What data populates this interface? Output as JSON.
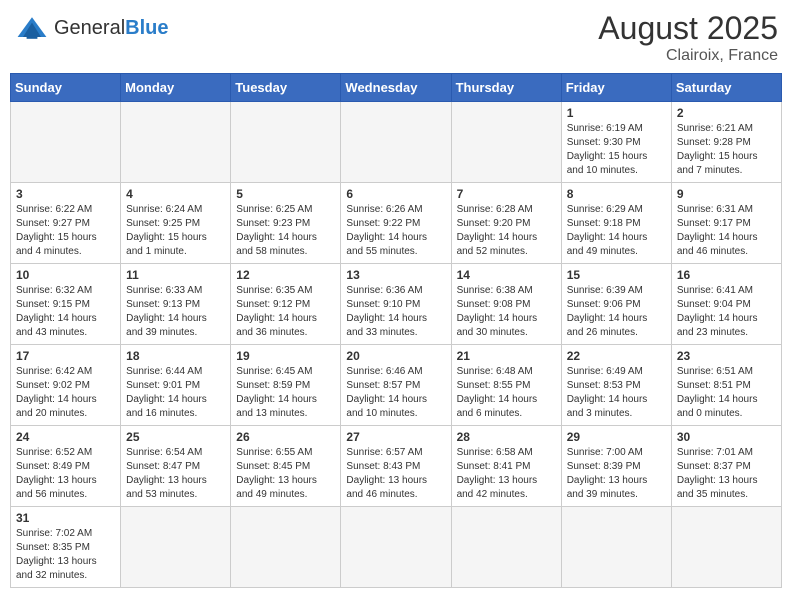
{
  "header": {
    "logo_general": "General",
    "logo_blue": "Blue",
    "month_title": "August 2025",
    "location": "Clairoix, France"
  },
  "days_of_week": [
    "Sunday",
    "Monday",
    "Tuesday",
    "Wednesday",
    "Thursday",
    "Friday",
    "Saturday"
  ],
  "weeks": [
    [
      {
        "day": "",
        "info": ""
      },
      {
        "day": "",
        "info": ""
      },
      {
        "day": "",
        "info": ""
      },
      {
        "day": "",
        "info": ""
      },
      {
        "day": "",
        "info": ""
      },
      {
        "day": "1",
        "info": "Sunrise: 6:19 AM\nSunset: 9:30 PM\nDaylight: 15 hours and 10 minutes."
      },
      {
        "day": "2",
        "info": "Sunrise: 6:21 AM\nSunset: 9:28 PM\nDaylight: 15 hours and 7 minutes."
      }
    ],
    [
      {
        "day": "3",
        "info": "Sunrise: 6:22 AM\nSunset: 9:27 PM\nDaylight: 15 hours and 4 minutes."
      },
      {
        "day": "4",
        "info": "Sunrise: 6:24 AM\nSunset: 9:25 PM\nDaylight: 15 hours and 1 minute."
      },
      {
        "day": "5",
        "info": "Sunrise: 6:25 AM\nSunset: 9:23 PM\nDaylight: 14 hours and 58 minutes."
      },
      {
        "day": "6",
        "info": "Sunrise: 6:26 AM\nSunset: 9:22 PM\nDaylight: 14 hours and 55 minutes."
      },
      {
        "day": "7",
        "info": "Sunrise: 6:28 AM\nSunset: 9:20 PM\nDaylight: 14 hours and 52 minutes."
      },
      {
        "day": "8",
        "info": "Sunrise: 6:29 AM\nSunset: 9:18 PM\nDaylight: 14 hours and 49 minutes."
      },
      {
        "day": "9",
        "info": "Sunrise: 6:31 AM\nSunset: 9:17 PM\nDaylight: 14 hours and 46 minutes."
      }
    ],
    [
      {
        "day": "10",
        "info": "Sunrise: 6:32 AM\nSunset: 9:15 PM\nDaylight: 14 hours and 43 minutes."
      },
      {
        "day": "11",
        "info": "Sunrise: 6:33 AM\nSunset: 9:13 PM\nDaylight: 14 hours and 39 minutes."
      },
      {
        "day": "12",
        "info": "Sunrise: 6:35 AM\nSunset: 9:12 PM\nDaylight: 14 hours and 36 minutes."
      },
      {
        "day": "13",
        "info": "Sunrise: 6:36 AM\nSunset: 9:10 PM\nDaylight: 14 hours and 33 minutes."
      },
      {
        "day": "14",
        "info": "Sunrise: 6:38 AM\nSunset: 9:08 PM\nDaylight: 14 hours and 30 minutes."
      },
      {
        "day": "15",
        "info": "Sunrise: 6:39 AM\nSunset: 9:06 PM\nDaylight: 14 hours and 26 minutes."
      },
      {
        "day": "16",
        "info": "Sunrise: 6:41 AM\nSunset: 9:04 PM\nDaylight: 14 hours and 23 minutes."
      }
    ],
    [
      {
        "day": "17",
        "info": "Sunrise: 6:42 AM\nSunset: 9:02 PM\nDaylight: 14 hours and 20 minutes."
      },
      {
        "day": "18",
        "info": "Sunrise: 6:44 AM\nSunset: 9:01 PM\nDaylight: 14 hours and 16 minutes."
      },
      {
        "day": "19",
        "info": "Sunrise: 6:45 AM\nSunset: 8:59 PM\nDaylight: 14 hours and 13 minutes."
      },
      {
        "day": "20",
        "info": "Sunrise: 6:46 AM\nSunset: 8:57 PM\nDaylight: 14 hours and 10 minutes."
      },
      {
        "day": "21",
        "info": "Sunrise: 6:48 AM\nSunset: 8:55 PM\nDaylight: 14 hours and 6 minutes."
      },
      {
        "day": "22",
        "info": "Sunrise: 6:49 AM\nSunset: 8:53 PM\nDaylight: 14 hours and 3 minutes."
      },
      {
        "day": "23",
        "info": "Sunrise: 6:51 AM\nSunset: 8:51 PM\nDaylight: 14 hours and 0 minutes."
      }
    ],
    [
      {
        "day": "24",
        "info": "Sunrise: 6:52 AM\nSunset: 8:49 PM\nDaylight: 13 hours and 56 minutes."
      },
      {
        "day": "25",
        "info": "Sunrise: 6:54 AM\nSunset: 8:47 PM\nDaylight: 13 hours and 53 minutes."
      },
      {
        "day": "26",
        "info": "Sunrise: 6:55 AM\nSunset: 8:45 PM\nDaylight: 13 hours and 49 minutes."
      },
      {
        "day": "27",
        "info": "Sunrise: 6:57 AM\nSunset: 8:43 PM\nDaylight: 13 hours and 46 minutes."
      },
      {
        "day": "28",
        "info": "Sunrise: 6:58 AM\nSunset: 8:41 PM\nDaylight: 13 hours and 42 minutes."
      },
      {
        "day": "29",
        "info": "Sunrise: 7:00 AM\nSunset: 8:39 PM\nDaylight: 13 hours and 39 minutes."
      },
      {
        "day": "30",
        "info": "Sunrise: 7:01 AM\nSunset: 8:37 PM\nDaylight: 13 hours and 35 minutes."
      }
    ],
    [
      {
        "day": "31",
        "info": "Sunrise: 7:02 AM\nSunset: 8:35 PM\nDaylight: 13 hours and 32 minutes."
      },
      {
        "day": "",
        "info": ""
      },
      {
        "day": "",
        "info": ""
      },
      {
        "day": "",
        "info": ""
      },
      {
        "day": "",
        "info": ""
      },
      {
        "day": "",
        "info": ""
      },
      {
        "day": "",
        "info": ""
      }
    ]
  ]
}
